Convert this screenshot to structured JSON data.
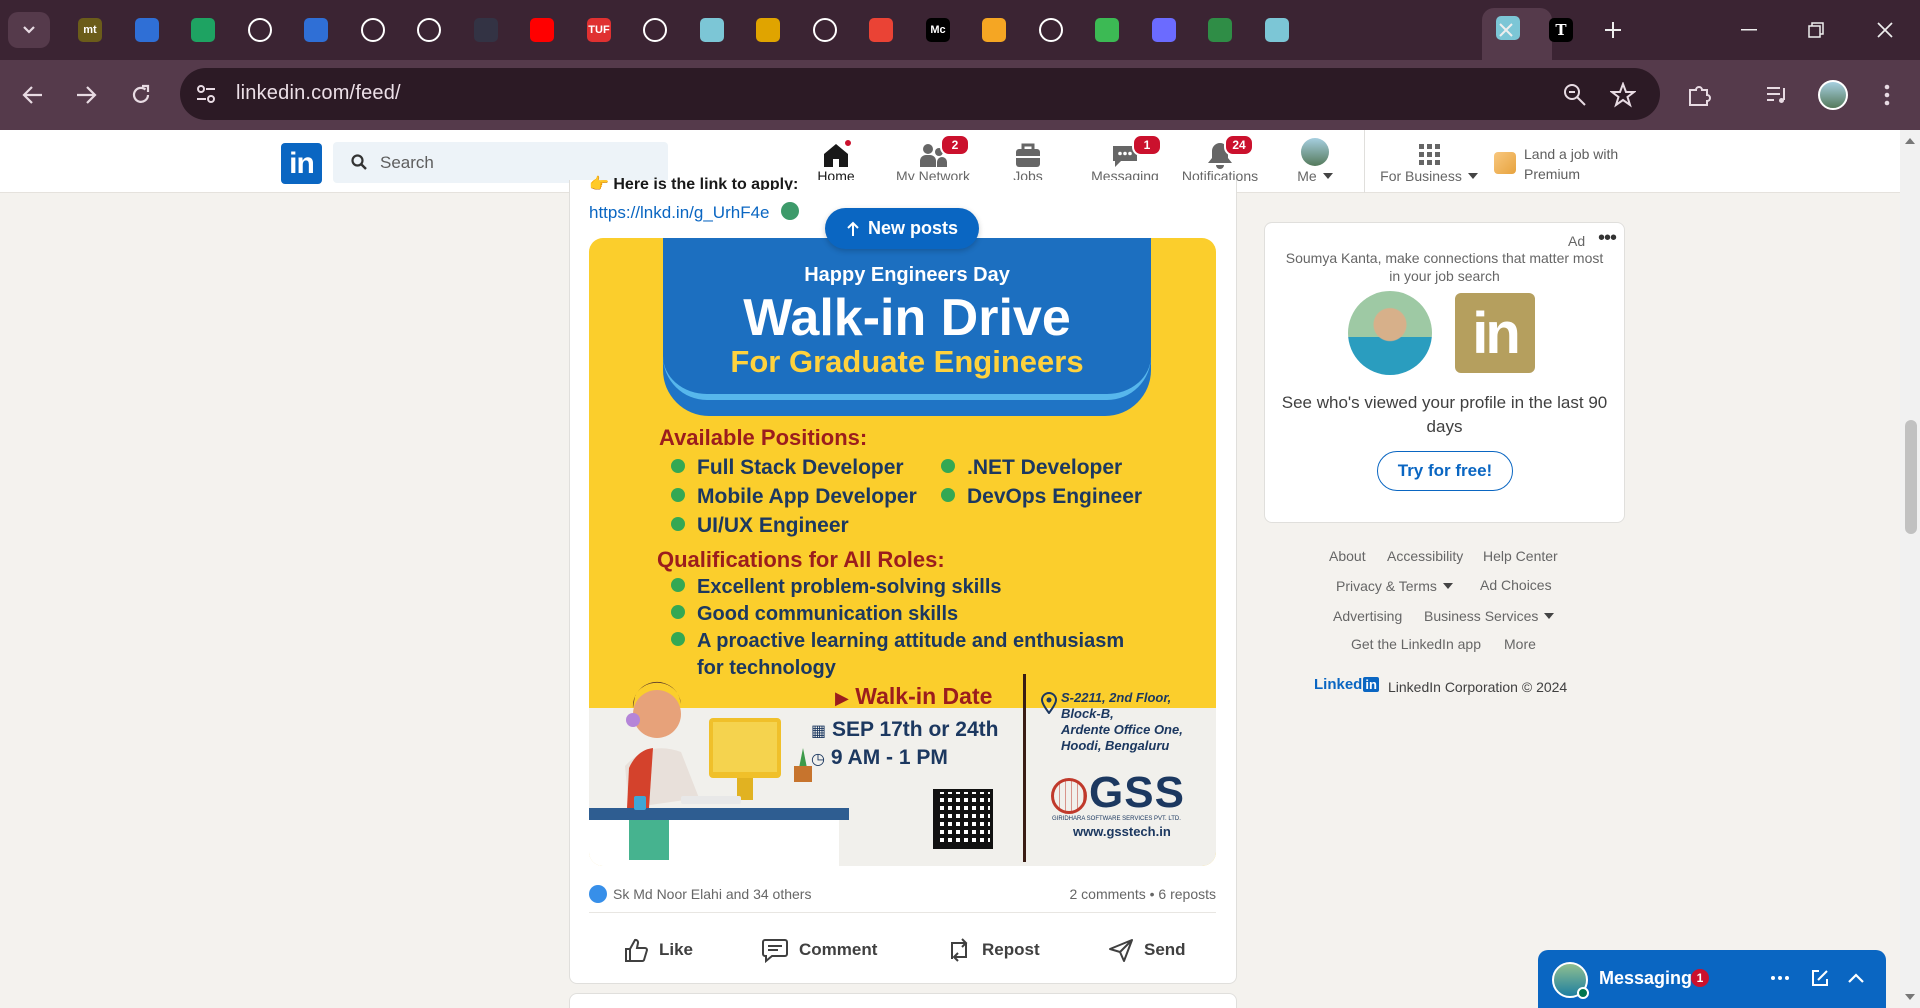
{
  "browser": {
    "url": "linkedin.com/feed/",
    "tabs": [
      {
        "icon": "mt-icon",
        "text": "mt",
        "color": "#6b5c1a"
      },
      {
        "icon": "tab-cf-icon",
        "text": "",
        "color": "#2f6fd6"
      },
      {
        "icon": "google-drive-icon",
        "text": "",
        "color": "#1ea362"
      },
      {
        "icon": "github-icon",
        "text": "",
        "color": "#ffffff"
      },
      {
        "icon": "tab-cf-icon",
        "text": "",
        "color": "#2f6fd6"
      },
      {
        "icon": "github-icon",
        "text": "",
        "color": "#ffffff"
      },
      {
        "icon": "chatgpt-icon",
        "text": "",
        "color": "#ffffff"
      },
      {
        "icon": "tab-site-icon",
        "text": "",
        "color": "#334"
      },
      {
        "icon": "youtube-icon",
        "text": "",
        "color": "#ff0000"
      },
      {
        "icon": "tuf-icon",
        "text": "TUF",
        "color": "#e03131"
      },
      {
        "icon": "speaker-icon",
        "text": "",
        "color": "#ffffff"
      },
      {
        "icon": "mountain-icon",
        "text": "",
        "color": "#7cc6d6"
      },
      {
        "icon": "candlestick-icon",
        "text": "",
        "color": "#e0a400"
      },
      {
        "icon": "github-icon",
        "text": "",
        "color": "#ffffff"
      },
      {
        "icon": "gmail-icon",
        "text": "",
        "color": "#ea4335"
      },
      {
        "icon": "medium-icon",
        "text": "Mc",
        "color": "#000000"
      },
      {
        "icon": "tab-site-icon",
        "text": "",
        "color": "#f5a623"
      },
      {
        "icon": "rocket-icon",
        "text": "",
        "color": "#ffffff"
      },
      {
        "icon": "leaf-icon",
        "text": "",
        "color": "#3cba54"
      },
      {
        "icon": "tab-site-icon",
        "text": "",
        "color": "#6b6bff"
      },
      {
        "icon": "gfg-icon",
        "text": "",
        "color": "#2f8d46"
      },
      {
        "icon": "mountain-icon",
        "text": "",
        "color": "#7cc6d6"
      }
    ]
  },
  "linkedin": {
    "search_placeholder": "Search",
    "nav": [
      {
        "label": "Home",
        "badge": ""
      },
      {
        "label": "My Network",
        "badge": "2"
      },
      {
        "label": "Jobs",
        "badge": ""
      },
      {
        "label": "Messaging",
        "badge": "1"
      },
      {
        "label": "Notifications",
        "badge": "24"
      },
      {
        "label": "Me",
        "badge": ""
      },
      {
        "label": "For Business",
        "badge": ""
      }
    ],
    "premium_line1": "Land a job with",
    "premium_line2": "Premium"
  },
  "post": {
    "prev_line": "👉 Here is the link to apply:",
    "link": "https://lnkd.in/g_UrhF4e",
    "new_posts": "New posts",
    "banner": {
      "tagline": "Happy Engineers Day",
      "title": "Walk-in Drive",
      "subtitle": "For Graduate Engineers",
      "positions_heading": "Available Positions:",
      "positions": [
        "Full Stack Developer",
        ".NET Developer",
        "Mobile App Developer",
        "DevOps Engineer",
        "UI/UX Engineer"
      ],
      "qual_heading": "Qualifications for All Roles:",
      "qualifications": [
        "Excellent problem-solving skills",
        "Good communication skills",
        "A proactive learning attitude and enthusiasm",
        "for technology"
      ],
      "date_heading": "Walk-in Date",
      "date": "SEP 17th or 24th",
      "time": "9 AM - 1 PM",
      "address": [
        "S-2211, 2nd Floor,",
        "Block-B,",
        "Ardente Office One,",
        "Hoodi, Bengaluru"
      ],
      "company": "GSS",
      "company_full": "GIRIDHARA SOFTWARE SERVICES PVT. LTD.",
      "website": "www.gsstech.in"
    },
    "reactions": "Sk Md Noor Elahi and 34 others",
    "comments_reposts": "2 comments • 6 reposts",
    "actions": [
      "Like",
      "Comment",
      "Repost",
      "Send"
    ]
  },
  "ad": {
    "label": "Ad",
    "message": "Soumya Kanta, make connections that matter most in your job search",
    "text": "See who's viewed your profile in the last 90 days",
    "cta": "Try for free!"
  },
  "footer": {
    "links": [
      "About",
      "Accessibility",
      "Help Center",
      "Privacy & Terms",
      "Ad Choices",
      "Advertising",
      "Business Services",
      "Get the LinkedIn app",
      "More"
    ],
    "brand": "Linked",
    "brand_in": "in",
    "copyright": "LinkedIn Corporation © 2024"
  },
  "messaging": {
    "title": "Messaging",
    "badge": "1"
  }
}
